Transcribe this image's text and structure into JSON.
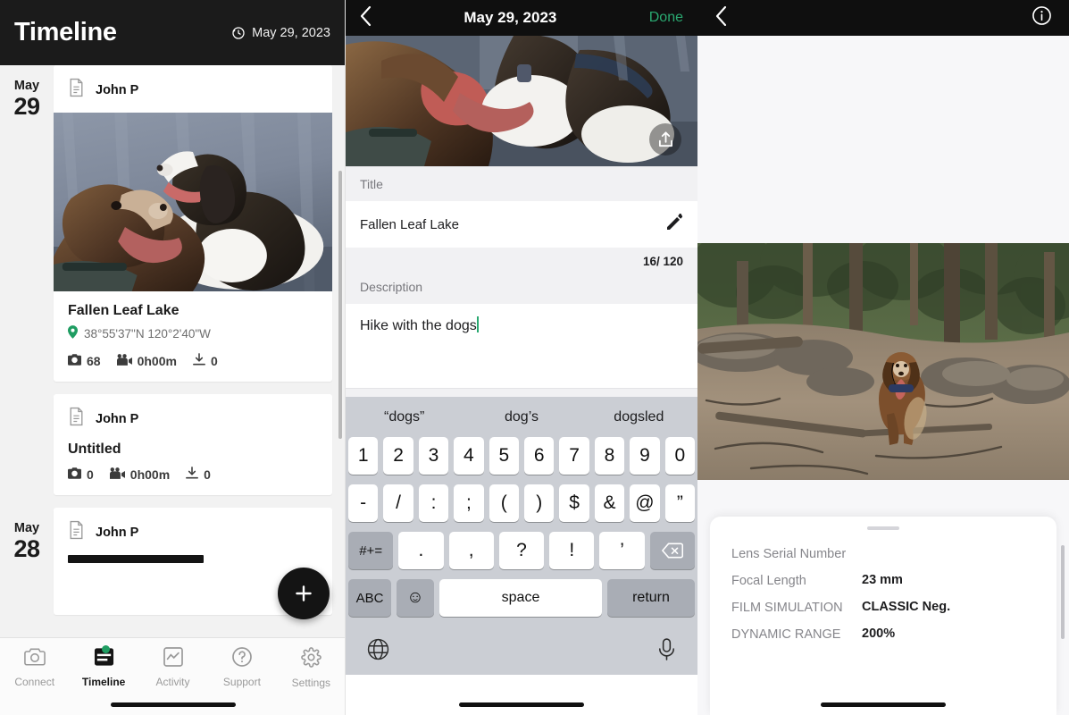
{
  "timeline": {
    "header": {
      "title": "Timeline",
      "date": "May 29, 2023",
      "clock_icon": "history-clock-icon"
    },
    "groups": [
      {
        "month": "May",
        "day": "29",
        "cards": [
          {
            "author": "John P",
            "doc_icon": "document-icon",
            "has_photo": true,
            "photo_alt": "two spaniel dogs lying in a car",
            "title": "Fallen Leaf Lake",
            "coords": "38°55'37\"N  120°2'40\"W",
            "stats": {
              "photos": "68",
              "duration": "0h00m",
              "downloads": "0"
            }
          },
          {
            "author": "John P",
            "doc_icon": "document-icon",
            "has_photo": false,
            "title": "Untitled",
            "coords": "",
            "stats": {
              "photos": "0",
              "duration": "0h00m",
              "downloads": "0"
            }
          }
        ]
      },
      {
        "month": "May",
        "day": "28",
        "cards": [
          {
            "author": "John P",
            "doc_icon": "document-icon",
            "has_photo": false,
            "title": "",
            "coords": "",
            "stats": {
              "photos": "",
              "duration": "",
              "downloads": ""
            }
          }
        ]
      }
    ],
    "fab_label": "+",
    "tabs": [
      {
        "label": "Connect",
        "icon": "camera-icon",
        "active": false,
        "badge": false
      },
      {
        "label": "Timeline",
        "icon": "timeline-icon",
        "active": true,
        "badge": true
      },
      {
        "label": "Activity",
        "icon": "activity-chart-icon",
        "active": false,
        "badge": false
      },
      {
        "label": "Support",
        "icon": "question-circle-icon",
        "active": false,
        "badge": false
      },
      {
        "label": "Settings",
        "icon": "gear-icon",
        "active": false,
        "badge": false
      }
    ]
  },
  "editor": {
    "header": {
      "back_icon": "chevron-left-icon",
      "title": "May 29, 2023",
      "done_label": "Done"
    },
    "photo_alt": "two spaniel dogs close-up in a car",
    "share_icon": "share-upload-icon",
    "title_label": "Title",
    "title_value": "Fallen Leaf Lake",
    "edit_icon": "pencil-edit-icon",
    "char_count": "16/ 120",
    "description_label": "Description",
    "description_value": "Hike with the dogs",
    "keyboard": {
      "suggestions": [
        "“dogs”",
        "dog’s",
        "dogsled"
      ],
      "row1": [
        "1",
        "2",
        "3",
        "4",
        "5",
        "6",
        "7",
        "8",
        "9",
        "0"
      ],
      "row2": [
        "-",
        "/",
        ":",
        ";",
        "(",
        ")",
        "$",
        "&",
        "@",
        "”"
      ],
      "row3": {
        "symbols_key": "#+=",
        "keys": [
          ".",
          ",",
          "?",
          "!",
          "’"
        ],
        "delete_icon": "backspace-icon"
      },
      "row4": {
        "abc_key": "ABC",
        "emoji_key": "☺",
        "space_key": "space",
        "return_key": "return"
      },
      "row5": {
        "globe_icon": "globe-icon",
        "mic_icon": "microphone-icon"
      }
    }
  },
  "detail": {
    "header": {
      "back_icon": "chevron-left-icon",
      "info_icon": "info-circle-icon"
    },
    "photo_alt": "dog running in a forest clearing",
    "exif": [
      {
        "key": "Lens Serial Number",
        "value": ""
      },
      {
        "key": "Focal Length",
        "value": "23 mm"
      },
      {
        "key": "FILM SIMULATION",
        "value": "CLASSIC Neg."
      },
      {
        "key": "DYNAMIC RANGE",
        "value": "200%"
      }
    ]
  },
  "colors": {
    "accent_green": "#2aa971",
    "header_black": "#1b1b1b",
    "keyboard_bg": "#cbced4"
  }
}
